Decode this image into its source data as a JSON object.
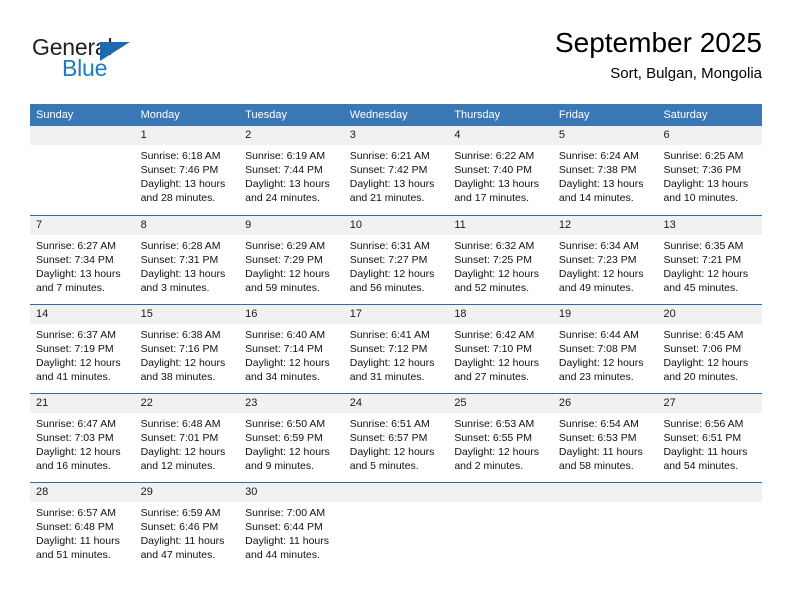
{
  "brand": {
    "name_part1": "General",
    "name_part2": "Blue",
    "accent_color": "#1e7ac4",
    "triangle_color": "#1e6bb0"
  },
  "header": {
    "month_title": "September 2025",
    "location": "Sort, Bulgan, Mongolia"
  },
  "calendar": {
    "header_color": "#3a78b5",
    "weekdays": [
      "Sunday",
      "Monday",
      "Tuesday",
      "Wednesday",
      "Thursday",
      "Friday",
      "Saturday"
    ],
    "weeks": [
      [
        {
          "day": "",
          "sunrise": "",
          "sunset": "",
          "daylight": ""
        },
        {
          "day": "1",
          "sunrise": "Sunrise: 6:18 AM",
          "sunset": "Sunset: 7:46 PM",
          "daylight": "Daylight: 13 hours and 28 minutes."
        },
        {
          "day": "2",
          "sunrise": "Sunrise: 6:19 AM",
          "sunset": "Sunset: 7:44 PM",
          "daylight": "Daylight: 13 hours and 24 minutes."
        },
        {
          "day": "3",
          "sunrise": "Sunrise: 6:21 AM",
          "sunset": "Sunset: 7:42 PM",
          "daylight": "Daylight: 13 hours and 21 minutes."
        },
        {
          "day": "4",
          "sunrise": "Sunrise: 6:22 AM",
          "sunset": "Sunset: 7:40 PM",
          "daylight": "Daylight: 13 hours and 17 minutes."
        },
        {
          "day": "5",
          "sunrise": "Sunrise: 6:24 AM",
          "sunset": "Sunset: 7:38 PM",
          "daylight": "Daylight: 13 hours and 14 minutes."
        },
        {
          "day": "6",
          "sunrise": "Sunrise: 6:25 AM",
          "sunset": "Sunset: 7:36 PM",
          "daylight": "Daylight: 13 hours and 10 minutes."
        }
      ],
      [
        {
          "day": "7",
          "sunrise": "Sunrise: 6:27 AM",
          "sunset": "Sunset: 7:34 PM",
          "daylight": "Daylight: 13 hours and 7 minutes."
        },
        {
          "day": "8",
          "sunrise": "Sunrise: 6:28 AM",
          "sunset": "Sunset: 7:31 PM",
          "daylight": "Daylight: 13 hours and 3 minutes."
        },
        {
          "day": "9",
          "sunrise": "Sunrise: 6:29 AM",
          "sunset": "Sunset: 7:29 PM",
          "daylight": "Daylight: 12 hours and 59 minutes."
        },
        {
          "day": "10",
          "sunrise": "Sunrise: 6:31 AM",
          "sunset": "Sunset: 7:27 PM",
          "daylight": "Daylight: 12 hours and 56 minutes."
        },
        {
          "day": "11",
          "sunrise": "Sunrise: 6:32 AM",
          "sunset": "Sunset: 7:25 PM",
          "daylight": "Daylight: 12 hours and 52 minutes."
        },
        {
          "day": "12",
          "sunrise": "Sunrise: 6:34 AM",
          "sunset": "Sunset: 7:23 PM",
          "daylight": "Daylight: 12 hours and 49 minutes."
        },
        {
          "day": "13",
          "sunrise": "Sunrise: 6:35 AM",
          "sunset": "Sunset: 7:21 PM",
          "daylight": "Daylight: 12 hours and 45 minutes."
        }
      ],
      [
        {
          "day": "14",
          "sunrise": "Sunrise: 6:37 AM",
          "sunset": "Sunset: 7:19 PM",
          "daylight": "Daylight: 12 hours and 41 minutes."
        },
        {
          "day": "15",
          "sunrise": "Sunrise: 6:38 AM",
          "sunset": "Sunset: 7:16 PM",
          "daylight": "Daylight: 12 hours and 38 minutes."
        },
        {
          "day": "16",
          "sunrise": "Sunrise: 6:40 AM",
          "sunset": "Sunset: 7:14 PM",
          "daylight": "Daylight: 12 hours and 34 minutes."
        },
        {
          "day": "17",
          "sunrise": "Sunrise: 6:41 AM",
          "sunset": "Sunset: 7:12 PM",
          "daylight": "Daylight: 12 hours and 31 minutes."
        },
        {
          "day": "18",
          "sunrise": "Sunrise: 6:42 AM",
          "sunset": "Sunset: 7:10 PM",
          "daylight": "Daylight: 12 hours and 27 minutes."
        },
        {
          "day": "19",
          "sunrise": "Sunrise: 6:44 AM",
          "sunset": "Sunset: 7:08 PM",
          "daylight": "Daylight: 12 hours and 23 minutes."
        },
        {
          "day": "20",
          "sunrise": "Sunrise: 6:45 AM",
          "sunset": "Sunset: 7:06 PM",
          "daylight": "Daylight: 12 hours and 20 minutes."
        }
      ],
      [
        {
          "day": "21",
          "sunrise": "Sunrise: 6:47 AM",
          "sunset": "Sunset: 7:03 PM",
          "daylight": "Daylight: 12 hours and 16 minutes."
        },
        {
          "day": "22",
          "sunrise": "Sunrise: 6:48 AM",
          "sunset": "Sunset: 7:01 PM",
          "daylight": "Daylight: 12 hours and 12 minutes."
        },
        {
          "day": "23",
          "sunrise": "Sunrise: 6:50 AM",
          "sunset": "Sunset: 6:59 PM",
          "daylight": "Daylight: 12 hours and 9 minutes."
        },
        {
          "day": "24",
          "sunrise": "Sunrise: 6:51 AM",
          "sunset": "Sunset: 6:57 PM",
          "daylight": "Daylight: 12 hours and 5 minutes."
        },
        {
          "day": "25",
          "sunrise": "Sunrise: 6:53 AM",
          "sunset": "Sunset: 6:55 PM",
          "daylight": "Daylight: 12 hours and 2 minutes."
        },
        {
          "day": "26",
          "sunrise": "Sunrise: 6:54 AM",
          "sunset": "Sunset: 6:53 PM",
          "daylight": "Daylight: 11 hours and 58 minutes."
        },
        {
          "day": "27",
          "sunrise": "Sunrise: 6:56 AM",
          "sunset": "Sunset: 6:51 PM",
          "daylight": "Daylight: 11 hours and 54 minutes."
        }
      ],
      [
        {
          "day": "28",
          "sunrise": "Sunrise: 6:57 AM",
          "sunset": "Sunset: 6:48 PM",
          "daylight": "Daylight: 11 hours and 51 minutes."
        },
        {
          "day": "29",
          "sunrise": "Sunrise: 6:59 AM",
          "sunset": "Sunset: 6:46 PM",
          "daylight": "Daylight: 11 hours and 47 minutes."
        },
        {
          "day": "30",
          "sunrise": "Sunrise: 7:00 AM",
          "sunset": "Sunset: 6:44 PM",
          "daylight": "Daylight: 11 hours and 44 minutes."
        },
        {
          "day": "",
          "sunrise": "",
          "sunset": "",
          "daylight": ""
        },
        {
          "day": "",
          "sunrise": "",
          "sunset": "",
          "daylight": ""
        },
        {
          "day": "",
          "sunrise": "",
          "sunset": "",
          "daylight": ""
        },
        {
          "day": "",
          "sunrise": "",
          "sunset": "",
          "daylight": ""
        }
      ]
    ]
  }
}
